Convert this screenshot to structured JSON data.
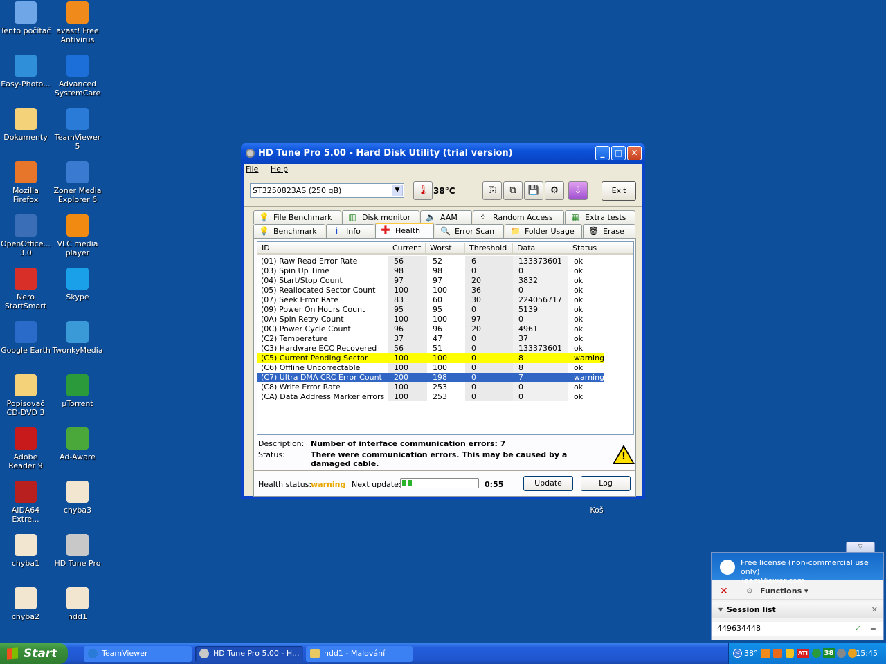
{
  "desktop": {
    "icons": [
      {
        "label": "Tento počítač",
        "icon": "computer-icon",
        "color": "#6fa6e8"
      },
      {
        "label": "avast! Free Antivirus",
        "icon": "avast-icon",
        "color": "#f08a1a"
      },
      {
        "label": "Easy-Photo...",
        "icon": "photo-icon",
        "color": "#2f8fd8"
      },
      {
        "label": "Advanced SystemCare",
        "icon": "systemcare-icon",
        "color": "#1c6fd8"
      },
      {
        "label": "Dokumenty",
        "icon": "documents-folder-icon",
        "color": "#f4d27a"
      },
      {
        "label": "TeamViewer 5",
        "icon": "teamviewer-icon",
        "color": "#2a7ad8"
      },
      {
        "label": "Mozilla Firefox",
        "icon": "firefox-icon",
        "color": "#e8762a"
      },
      {
        "label": "Zoner Media Explorer 6",
        "icon": "zoner-icon",
        "color": "#3a7ad0"
      },
      {
        "label": "OpenOffice... 3.0",
        "icon": "openoffice-icon",
        "color": "#3a6fb8"
      },
      {
        "label": "VLC media player",
        "icon": "vlc-icon",
        "color": "#f08a10"
      },
      {
        "label": "Nero StartSmart",
        "icon": "nero-icon",
        "color": "#d83028"
      },
      {
        "label": "Skype",
        "icon": "skype-icon",
        "color": "#1aa0e8"
      },
      {
        "label": "Google Earth",
        "icon": "google-earth-icon",
        "color": "#2a6ac8"
      },
      {
        "label": "TwonkyMedia",
        "icon": "twonky-icon",
        "color": "#3a9ad8"
      },
      {
        "label": "Popisovač CD-DVD 3",
        "icon": "folder-icon",
        "color": "#f4d27a"
      },
      {
        "label": "µTorrent",
        "icon": "utorrent-icon",
        "color": "#2a9a3a"
      },
      {
        "label": "Adobe Reader 9",
        "icon": "adobe-reader-icon",
        "color": "#c81a1a"
      },
      {
        "label": "Ad-Aware",
        "icon": "adaware-icon",
        "color": "#4aa83a"
      },
      {
        "label": "AIDA64 Extre...",
        "icon": "aida64-icon",
        "color": "#b82020"
      },
      {
        "label": "chyba3",
        "icon": "image-file-icon",
        "color": "#f2e6d0"
      },
      {
        "label": "chyba1",
        "icon": "image-file-icon",
        "color": "#f2e6d0"
      },
      {
        "label": "HD Tune Pro",
        "icon": "hdtune-icon",
        "color": "#c8c8c8"
      },
      {
        "label": "chyba2",
        "icon": "image-file-icon",
        "color": "#f2e6d0"
      },
      {
        "label": "hdd1",
        "icon": "image-file-icon",
        "color": "#f2e6d0"
      }
    ],
    "recycle_bin": "Koš"
  },
  "window": {
    "title": "HD Tune Pro 5.00 - Hard Disk Utility (trial version)",
    "menu": [
      "File",
      "Help"
    ],
    "drive": "ST3250823AS (250 gB)",
    "temperature": "38°C",
    "exit_label": "Exit",
    "tabs_top": [
      "File Benchmark",
      "Disk monitor",
      "AAM",
      "Random Access",
      "Extra tests"
    ],
    "tabs_bottom": [
      "Benchmark",
      "Info",
      "Health",
      "Error Scan",
      "Folder Usage",
      "Erase"
    ],
    "active_tab": "Health",
    "columns": [
      "ID",
      "Current",
      "Worst",
      "Threshold",
      "Data",
      "Status"
    ],
    "rows": [
      {
        "id": "(01) Raw Read Error Rate",
        "current": "56",
        "worst": "52",
        "threshold": "6",
        "data": "133373601",
        "status": "ok",
        "hl": ""
      },
      {
        "id": "(03) Spin Up Time",
        "current": "98",
        "worst": "98",
        "threshold": "0",
        "data": "0",
        "status": "ok",
        "hl": ""
      },
      {
        "id": "(04) Start/Stop Count",
        "current": "97",
        "worst": "97",
        "threshold": "20",
        "data": "3832",
        "status": "ok",
        "hl": ""
      },
      {
        "id": "(05) Reallocated Sector Count",
        "current": "100",
        "worst": "100",
        "threshold": "36",
        "data": "0",
        "status": "ok",
        "hl": ""
      },
      {
        "id": "(07) Seek Error Rate",
        "current": "83",
        "worst": "60",
        "threshold": "30",
        "data": "224056717",
        "status": "ok",
        "hl": ""
      },
      {
        "id": "(09) Power On Hours Count",
        "current": "95",
        "worst": "95",
        "threshold": "0",
        "data": "5139",
        "status": "ok",
        "hl": ""
      },
      {
        "id": "(0A) Spin Retry Count",
        "current": "100",
        "worst": "100",
        "threshold": "97",
        "data": "0",
        "status": "ok",
        "hl": ""
      },
      {
        "id": "(0C) Power Cycle Count",
        "current": "96",
        "worst": "96",
        "threshold": "20",
        "data": "4961",
        "status": "ok",
        "hl": ""
      },
      {
        "id": "(C2) Temperature",
        "current": "37",
        "worst": "47",
        "threshold": "0",
        "data": "37",
        "status": "ok",
        "hl": ""
      },
      {
        "id": "(C3) Hardware ECC Recovered",
        "current": "56",
        "worst": "51",
        "threshold": "0",
        "data": "133373601",
        "status": "ok",
        "hl": ""
      },
      {
        "id": "(C5) Current Pending Sector",
        "current": "100",
        "worst": "100",
        "threshold": "0",
        "data": "8",
        "status": "warning",
        "hl": "yellow"
      },
      {
        "id": "(C6) Offline Uncorrectable",
        "current": "100",
        "worst": "100",
        "threshold": "0",
        "data": "8",
        "status": "ok",
        "hl": ""
      },
      {
        "id": "(C7) Ultra DMA CRC Error Count",
        "current": "200",
        "worst": "198",
        "threshold": "0",
        "data": "7",
        "status": "warning",
        "hl": "blue"
      },
      {
        "id": "(C8) Write Error Rate",
        "current": "100",
        "worst": "253",
        "threshold": "0",
        "data": "0",
        "status": "ok",
        "hl": ""
      },
      {
        "id": "(CA) Data Address Marker errors",
        "current": "100",
        "worst": "253",
        "threshold": "0",
        "data": "0",
        "status": "ok",
        "hl": ""
      }
    ],
    "description_label": "Description:",
    "description": "Number of interface communication errors: 7",
    "status_label": "Status:",
    "status": "There were communication errors. This may be caused by a damaged cable.",
    "health_label": "Health status:",
    "health_value": "warning",
    "health_color": "#e8a800",
    "next_update_label": "Next update:",
    "next_update_progress": 0.13,
    "countdown": "0:55",
    "update_label": "Update",
    "log_label": "Log"
  },
  "teamviewer_panel": {
    "license": "Free license (non-commercial use only)",
    "site": "TeamViewer.com",
    "functions": "Functions",
    "session_list": "Session list",
    "session_id": "449634448"
  },
  "taskbar": {
    "start": "Start",
    "items": [
      "TeamViewer",
      "HD Tune Pro 5.00 - H...",
      "hdd1 - Malování"
    ],
    "tray_temp": "38°",
    "tray_badge": "38",
    "clock": "15:45"
  }
}
